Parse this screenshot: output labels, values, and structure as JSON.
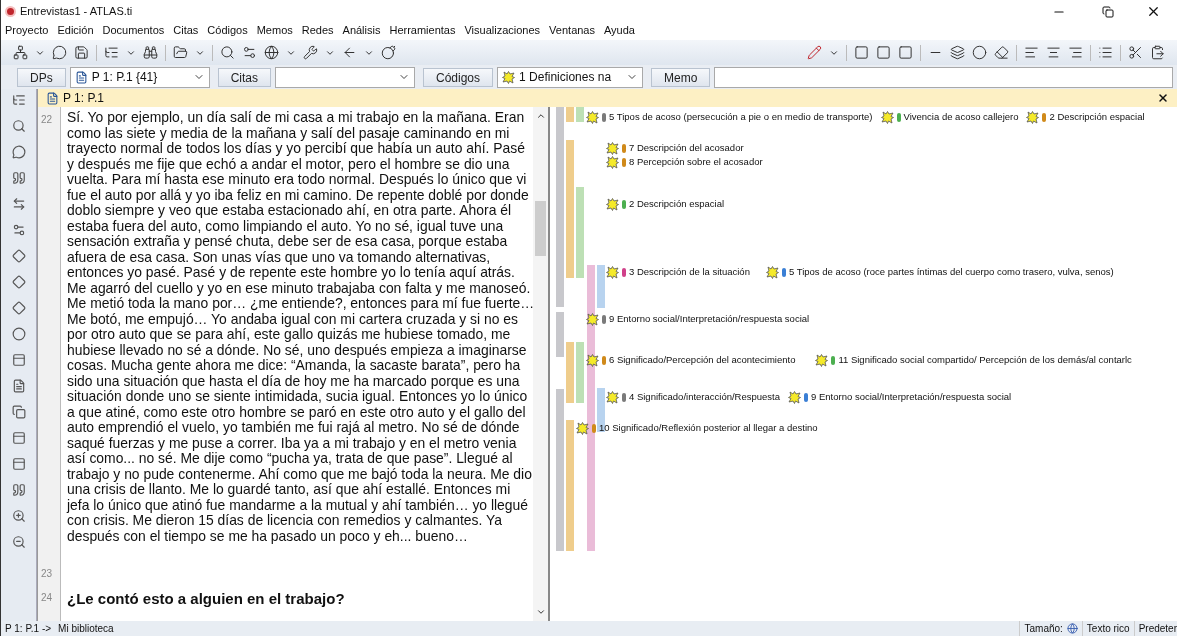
{
  "window": {
    "title": "Entrevistas1 - ATLAS.ti"
  },
  "menu": [
    "Proyecto",
    "Edición",
    "Documentos",
    "Citas",
    "Códigos",
    "Memos",
    "Redes",
    "Análisis",
    "Herramientas",
    "Visualizaciones",
    "Ventanas",
    "Ayuda"
  ],
  "selector_bar": [
    {
      "kind": "button",
      "label": "DPs"
    },
    {
      "kind": "combo",
      "value": "P 1: P.1 {41}"
    },
    {
      "kind": "button",
      "label": "Citas"
    },
    {
      "kind": "combo"
    },
    {
      "kind": "button",
      "label": "Códigos"
    },
    {
      "kind": "combo",
      "value": "1 Definiciones na"
    },
    {
      "kind": "button",
      "label": "Memo"
    },
    {
      "kind": "field"
    }
  ],
  "document": {
    "title": "P 1: P.1",
    "paragraphs": [
      {
        "number": "22",
        "kind": "text",
        "text": "Sí. Yo por ejemplo, un día salí de mi casa a mi trabajo en la mañana. Eran como las siete y media de la mañana y salí del pasaje caminando en mi trayecto normal de todos los días y yo percibí que había un auto ahí. Pasé y después me fije que echó a andar el motor, pero el hombre se dio una vuelta. Para mí hasta ese minuto era todo normal. Después lo único que vi fue el auto por allá y yo iba feliz en mi camino. De repente doblé por donde doblo siempre y veo que estaba estacionado ahí, en otra parte. Ahora él estaba fuera del auto, como limpiando el auto. Yo no sé, igual tuve una sensación extraña y pensé chuta, debe ser de esa casa, porque estaba afuera de esa casa. Son unas vías que uno va tomando alternativas, entonces yo pasé. Pasé y de repente este hombre yo lo tenía aquí atrás. Me agarró del cuello y yo en ese minuto trabajaba con falta y me manoseó. Me metió toda la mano por… ¿me entiende?, entonces para mí fue fuerte… Me botó, me empujó… Yo andaba igual con mi cartera cruzada y si no es por otro auto que se para ahí, este gallo quizás me hubiese tomado, me hubiese llevado no sé a dónde. No sé, uno después empieza a imaginarse cosas. Mucha gente ahora me dice: “Amanda, la sacaste barata”, pero ha sido una situación que hasta el día de hoy me ha marcado porque es una situación donde uno se siente intimidada, sucia igual. Entonces yo lo único a que atiné, como este otro hombre se paró en este otro auto y el gallo del auto emprendió el vuelo, yo también me fui rajá al metro. No sé de dónde saqué fuerzas y me puse a correr. Iba ya a mi trabajo y en el metro venia así como... no sé. Me dije como “pucha ya, trata de que pase”. Llegué al trabajo y no pude contenerme. Ahí como que me bajó toda la neura. Me dio una crisis de llanto. Me lo guardé tanto, así que ahí estallé. Entonces mi jefa lo único que atinó fue mandarme a la mutual y ahí  también… yo llegué con crisis. Me dieron 15 días de licencia con remedios y calmantes. Ya después con el tiempo se me ha pasado un poco y eh... bueno…"
      },
      {
        "number": "23",
        "kind": "blank"
      },
      {
        "number": "24",
        "kind": "question",
        "text": "¿Le contó esto a alguien en el trabajo?"
      }
    ]
  },
  "margin": {
    "rows": [
      [
        {
          "label": "5 Tipos de acoso (persecución a pie o en medio de transporte)",
          "color": "#7a7a7a"
        },
        {
          "label": "Vivencia de acoso callejero",
          "color": "#4caf50"
        },
        {
          "label": "2 Descripción espacial",
          "color": "#d08a1a"
        }
      ],
      [
        {
          "label": "7 Descripción del acosador",
          "color": "#d08a1a"
        }
      ],
      [
        {
          "label": "8 Percepción sobre el acosador",
          "color": "#d08a1a"
        }
      ],
      [
        {
          "label": "2 Descripción espacial",
          "color": "#4caf50"
        }
      ],
      [
        {
          "label": "3 Descripción de la situación",
          "color": "#d0408a"
        },
        {
          "label": "5 Tipos de acoso (roce partes íntimas del cuerpo como trasero, vulva, senos)",
          "color": "#3a7fd5"
        }
      ],
      [
        {
          "label": "9 Entorno social/Interpretación/respuesta social",
          "color": "#7a7a7a"
        }
      ],
      [
        {
          "label": "6 Significado/Percepción del acontecimiento",
          "color": "#d08a1a"
        },
        {
          "label": "11 Significado social compartido/ Percepción de los demás/al contarlc",
          "color": "#4caf50"
        }
      ],
      [
        {
          "label": "4 Significado/interacción/Respuesta",
          "color": "#7a7a7a"
        },
        {
          "label": "9 Entorno social/Interpretación/respuesta social",
          "color": "#3a7fd5"
        }
      ],
      [
        {
          "label": "10 Significado/Reflexión posterior al llegar a destino",
          "color": "#d08a1a"
        }
      ]
    ]
  },
  "status_bar": {
    "path": "P 1: P.1 ->",
    "library": "Mi biblioteca",
    "size_label": "Tamaño:",
    "format": "Texto rico",
    "mode": "Predeter"
  }
}
